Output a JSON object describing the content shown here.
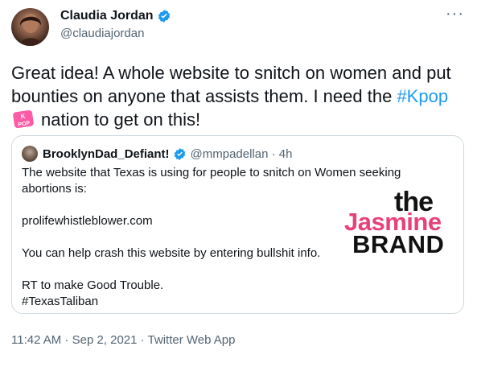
{
  "tweet": {
    "display_name": "Claudia Jordan",
    "handle": "@claudiajordan",
    "more_icon": "···",
    "text_part1": "Great idea! A whole website to snitch on women and put bounties on anyone that assists them. I need the ",
    "hashtag": "#Kpop",
    "kpop_emoji_text": "K POP",
    "text_part2": "nation to get on this!",
    "timestamp": "11:42 AM · Sep 2, 2021 · Twitter Web App"
  },
  "quote": {
    "display_name": "BrooklynDad_Defiant!",
    "handle_time": "@mmpadellan · 4h",
    "lines": [
      "The website that Texas is using for people to snitch on Women seeking abortions is:",
      "",
      "prolifewhistleblower.com",
      "",
      "You can help crash this website by entering bullshit info.",
      "",
      "RT to make Good Trouble.",
      "#TexasTaliban"
    ]
  },
  "watermark": {
    "the": "the",
    "jasmine": "Jasmine",
    "brand": "BRAND"
  },
  "colors": {
    "text": "#0f1419",
    "muted": "#536471",
    "link": "#1d9bf0",
    "verified": "#1d9bf0",
    "watermark_pink": "#e8417a"
  },
  "icons": [
    "verified-badge-icon",
    "more-options-icon",
    "kpop-emoji-icon"
  ]
}
